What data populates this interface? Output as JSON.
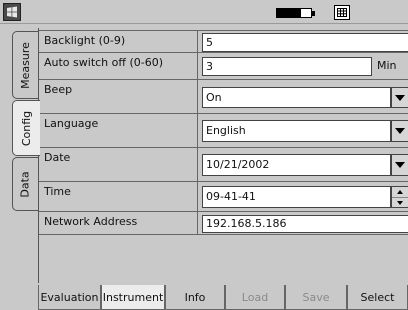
{
  "topbar": {
    "start_icon": "windows-start-icon",
    "battery_level": 0.72,
    "grid_icon": "grid-icon"
  },
  "side_tabs": [
    {
      "label": "Measure",
      "active": false
    },
    {
      "label": "Config",
      "active": true
    },
    {
      "label": "Data",
      "active": false
    }
  ],
  "config": {
    "backlight": {
      "label": "Backlight (0-9)",
      "value": "5"
    },
    "auto_switch_off": {
      "label": "Auto switch off (0-60)",
      "value": "3",
      "unit": "Min"
    },
    "beep": {
      "label": "Beep",
      "value": "On"
    },
    "language": {
      "label": "Language",
      "value": "English"
    },
    "date": {
      "label": "Date",
      "value": "10/21/2002"
    },
    "time": {
      "label": "Time",
      "value": "09-41-41"
    },
    "network_address": {
      "label": "Network Address",
      "value": "192.168.5.186"
    }
  },
  "bottom_tabs": [
    {
      "label": "Evaluation",
      "state": "normal"
    },
    {
      "label": "Instrument",
      "state": "active"
    },
    {
      "label": "Info",
      "state": "normal"
    },
    {
      "label": "Load",
      "state": "disabled"
    },
    {
      "label": "Save",
      "state": "disabled"
    },
    {
      "label": "Select",
      "state": "normal"
    }
  ]
}
